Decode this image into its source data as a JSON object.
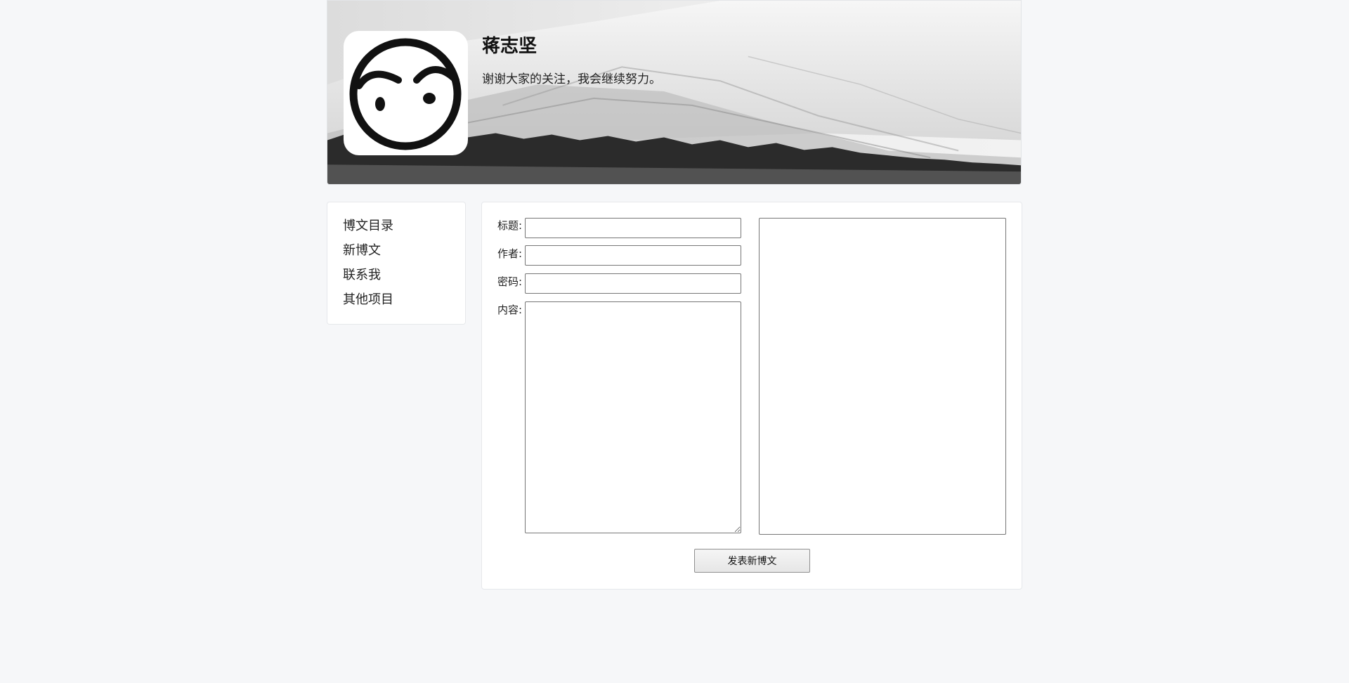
{
  "header": {
    "title": "蒋志坚",
    "motto": "谢谢大家的关注，我会继续努力。"
  },
  "sidebar": {
    "items": [
      {
        "label": "博文目录"
      },
      {
        "label": "新博文"
      },
      {
        "label": "联系我"
      },
      {
        "label": "其他项目"
      }
    ]
  },
  "form": {
    "title_label": "标题:",
    "title_value": "",
    "author_label": "作者:",
    "author_value": "",
    "password_label": "密码:",
    "password_value": "",
    "content_label": "内容:",
    "content_value": "",
    "preview_text": "",
    "submit_label": "发表新博文"
  },
  "colors": {
    "page_background": "#f6f7f9",
    "card_background": "#ffffff",
    "border": "#767676"
  },
  "icons": {
    "avatar": "ink-circle-face-logo",
    "resize": "resize-grip-icon"
  }
}
